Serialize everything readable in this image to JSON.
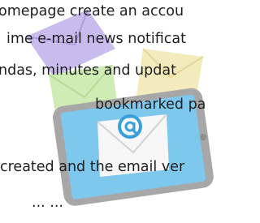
{
  "lines": [
    "omepage create an accou",
    "ime e-mail news notificat",
    "ndas, minutes and updat",
    "bookmarked pa",
    "created and the email ver",
    "... ..."
  ],
  "colors": {
    "tablet_frame": "#a7a7a7",
    "tablet_screen": "#7ec8ee",
    "envelope_purple": "#c8b8ee",
    "envelope_green": "#cdebb0",
    "envelope_yellow": "#f3eab9",
    "envelope_white": "#f7f7f7",
    "at_sign": "#3aa0dc"
  }
}
